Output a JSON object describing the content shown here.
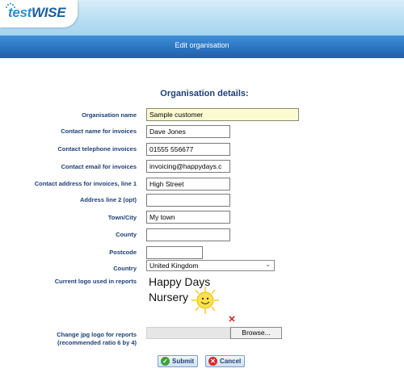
{
  "app": {
    "logo_part1": "test",
    "logo_part2": "WISE"
  },
  "header": {
    "title": "Edit organisation"
  },
  "form": {
    "section_title": "Organisation details:",
    "fields": {
      "org_name": {
        "label": "Organisation name",
        "value": "Sample customer"
      },
      "contact_name": {
        "label": "Contact name for invoices",
        "value": "Dave Jones"
      },
      "contact_phone": {
        "label": "Contact telephone invoices",
        "value": "01555 556677"
      },
      "contact_email": {
        "label": "Contact email for invoices",
        "value": "invoicing@happydays.c"
      },
      "address1": {
        "label": "Contact address for invoices, line 1",
        "value": "High Street"
      },
      "address2": {
        "label": "Address line 2 (opt)",
        "value": ""
      },
      "town": {
        "label": "Town/City",
        "value": "My town"
      },
      "county": {
        "label": "County",
        "value": ""
      },
      "postcode": {
        "label": "Postcode",
        "value": ""
      },
      "country": {
        "label": "Country",
        "value": "United Kingdom"
      }
    },
    "logo": {
      "label": "Current logo used in reports",
      "line1": "Happy Days",
      "line2": "Nursery"
    },
    "upload": {
      "label_line1": "Change jpg logo for reports",
      "label_line2": "(recommended ratio 6 by 4)",
      "browse_label": "Browse..."
    },
    "buttons": {
      "submit": "Submit",
      "cancel": "Cancel"
    }
  },
  "colors": {
    "label": "#1d3f77",
    "titlebar": "#2a72bf",
    "highlight_field": "#fdfbd2",
    "sun": "#ffe24a",
    "delete_x": "#d62b2b"
  }
}
